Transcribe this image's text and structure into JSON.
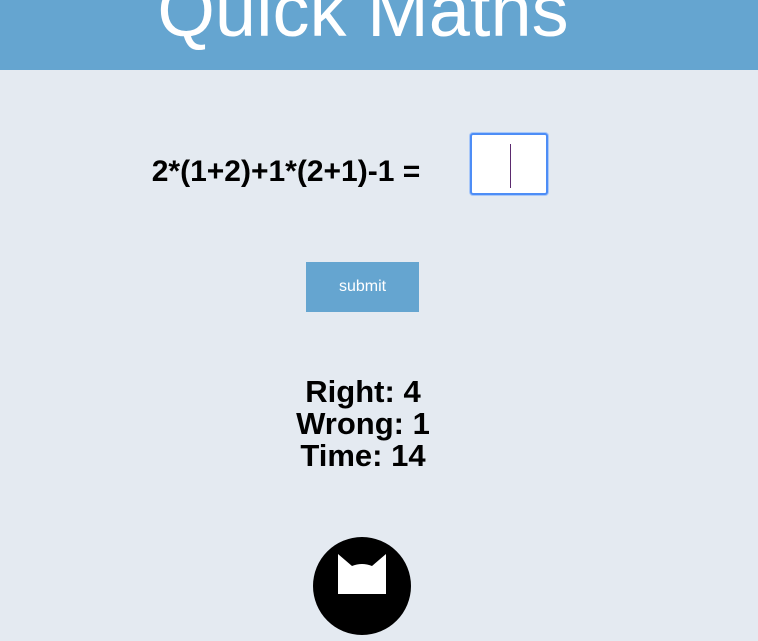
{
  "header": {
    "title": "Quick Maths"
  },
  "quiz": {
    "question": "2*(1+2)+1*(2+1)-1 =",
    "answer_value": "",
    "submit_label": "submit"
  },
  "stats": {
    "right_label": "Right:",
    "right_value": "4",
    "wrong_label": "Wrong:",
    "wrong_value": "1",
    "time_label": "Time:",
    "time_value": "14"
  },
  "footer": {
    "icon": "github-icon"
  },
  "colors": {
    "accent": "#65a5d0",
    "background": "#e4eaf1",
    "focus_ring": "#4d8df6"
  }
}
